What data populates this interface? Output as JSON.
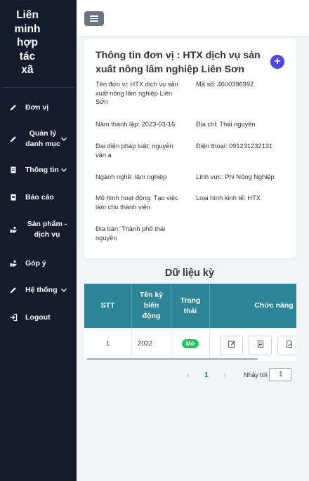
{
  "sidebar": {
    "brand": [
      "Liên",
      "minh",
      "hợp",
      "tác",
      "xã"
    ],
    "items": [
      {
        "label": "Đơn vị",
        "icon": "pencil-icon"
      },
      {
        "label": "Quản lý danh mục",
        "icon": "pencil-icon"
      },
      {
        "label": "Thông tin",
        "icon": "document-icon"
      },
      {
        "label": "Báo cáo",
        "icon": "document-icon"
      },
      {
        "label": "Sản phẩm - dịch vụ",
        "icon": "hand-icon"
      },
      {
        "label": "Góp ý",
        "icon": "hand-icon"
      },
      {
        "label": "Hệ thống",
        "icon": "pencil-icon"
      },
      {
        "label": "Logout",
        "icon": "logout-icon"
      }
    ]
  },
  "card": {
    "title": "Thông tin đơn vị : HTX dịch vụ sản xuất nông lâm nghiệp Liên Sơn",
    "fields": {
      "ten_don_vi": "Tên đơn vị: HTX dịch vụ sản xuất nông lâm nghiệp Liên Sơn",
      "ma_so": "Mã số: 4600396992",
      "nam_thanh_lap": "Năm thành lập: 2023-03-16",
      "dia_chi": "Địa chỉ: Thái nguyên",
      "dai_dien": "Đại diện pháp luật: nguyễn văn a",
      "dien_thoai": "Điện thoại: 091231232131",
      "nganh_nghe": "Ngành nghề: lâm nghiệp",
      "linh_vuc": "Lĩnh vực: Phi Nông Nghiệp",
      "mo_hinh": "Mô hình hoạt động: Tạo việc làm cho thành viên",
      "loai_hinh": "Loại hình kinh tế: HTX",
      "dia_ban": "Địa bàn: Thành phố thái nguyên"
    }
  },
  "data_section": {
    "title": "Dữ liệu kỳ",
    "columns": [
      "STT",
      "Tên kỳ biến động",
      "Trang thái",
      "Chức năng"
    ],
    "rows": [
      {
        "stt": "1",
        "ten_ky": "2022",
        "trang_thai": "Mở"
      }
    ]
  },
  "pagination": {
    "prev": "‹",
    "current": "1",
    "next": "›",
    "jump_label": "Nhảy tới",
    "jump_value": "1"
  },
  "colors": {
    "sidebar_bg": "#141b2d",
    "table_header": "#2b8597",
    "accent": "#4f46e5",
    "status_open": "#22c55e"
  }
}
